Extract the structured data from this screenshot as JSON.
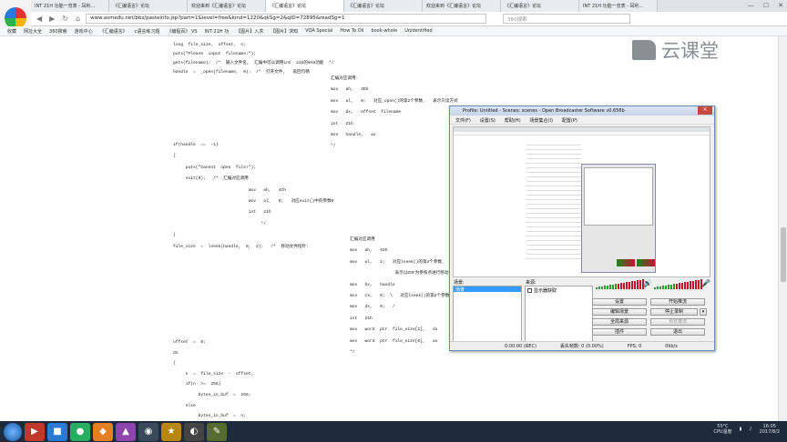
{
  "browser": {
    "tabs": [
      "INT 21H 功能一览表 - 耳利...",
      "《汇编语言》论坛",
      "欢迎来到《汇编语言》论坛",
      "《汇编语言》论坛",
      "《汇编语言》论坛",
      "欢迎来到《汇编语言》论坛",
      "《汇编语言》论坛",
      "INT 21H 功能一览表 - 耳利..."
    ],
    "url": "www.asmedu.net/bbs/pasteinfo.jsp?part=1&level=free&kind=1220&qkSg=2&qID=72895&readSg=1",
    "search_placeholder": "360搜索",
    "bookmarks": [
      "收藏",
      "网址大全",
      "360搜索",
      "游戏中心",
      "《汇编语言》",
      "c语言练习题",
      "《编程百》 VS",
      "INT 21H 功",
      "【图片】入求",
      "【图片】求知",
      "VOA Special",
      "How To Oil",
      "book-whole",
      "Unidentified"
    ]
  },
  "code": {
    "block1": "long  file_size,  offset,  n;\nputs(\"Please  input  filename:\");\ngets(filename);  /*  输入文件名,  汇编中可以调用int  21h的0AH功能  */\nhandle  =  _open(filename,  0);  /*  打开文件,   返回句柄",
    "block2": "汇编对应调用:\n\nmov   ah,   3Dh\n\nmov   al,   0;   对应_open()的第2个参数,   表示只读方式\n\nmov   dx,   offset  filename\n\nint   21h\n\nmov   handle,   ax\n\n*/",
    "block3": "if(handle  ==  -1)\n\n{\n\n     puts(\"Cannot  open  file!\");\n\n     exit(0);   /*  汇编对应调用\n\n                              mov   ah,   4Ch\n\n                              mov   al,   0;   对应exit()中的参数0\n\n                              int   21h\n\n                                   */\n\n}\n\nfile_size  =  lseek(handle,  0,  2);   /*  移动文件指针:",
    "block4": "汇编对应调用\n\nmov   ah,   42h\n\nmov   al,   2;   对应lseek()的第3个参数,\n\n                  表示以EOF为参照点进行移动\n\nmov   bx,   handle\n\nmov   cx,   0;  \\   对应lseek()的第2个参数\n\nmov   dx,   0;   /\n\nint   21h\n\nmov   word  ptr  file_size[2],   dx\n\nmov   word  ptr  file_size[0],   ax\n\n*/",
    "block5": "offset  =  0;\n\ndo\n\n{\n\n     n  =  file_size  -  offset;\n\n     if(n  >=  256)\n\n          bytes_in_buf  =  256;\n\n     else\n\n          bytes_in_buf  =  n;"
  },
  "watermark": {
    "text": "云课堂"
  },
  "obs": {
    "title": "Profile: Untitled - Scenes: scenes - Open Broadcaster Software v0.656b",
    "menu": [
      "文件(F)",
      "设置(S)",
      "帮助(H)",
      "场景集合(I)",
      "配置(P)"
    ],
    "scenes_label": "场景:",
    "sources_label": "来源:",
    "scene_selected": "场景",
    "source_item": "显示器获取",
    "buttons": {
      "settings": "设置",
      "start_stream": "开始推流",
      "edit_scene": "编辑场景",
      "stop_record": "停止录制",
      "global_sources": "全局来源",
      "preview_stream": "预览推流",
      "plugins": "插件",
      "exit": "退出"
    },
    "status": {
      "time": "0:00:00 (REC)",
      "dropped": "丢失帧数: 0 (0.00%)",
      "fps": "FPS: 0",
      "bitrate": "0kb/s"
    }
  },
  "taskbar": {
    "temp": "55°C",
    "cpu": "CPU温度",
    "time": "16:05",
    "date": "2017/8/2"
  }
}
